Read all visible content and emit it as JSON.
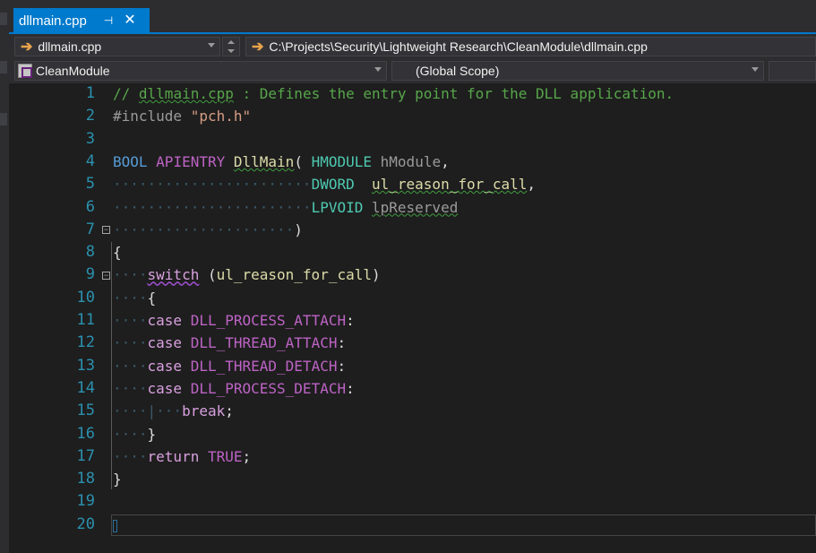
{
  "tab": {
    "label": "dllmain.cpp",
    "pin_glyph": "⊣",
    "close_glyph": "✕",
    "active_color": "#007acc"
  },
  "nav": {
    "file_combo": "dllmain.cpp",
    "path": "C:\\Projects\\Security\\Lightweight Research\\CleanModule\\dllmain.cpp",
    "project_combo": "CleanModule",
    "scope_combo": "(Global Scope)"
  },
  "lines": [
    {
      "n": "1",
      "parts": [
        [
          "c-comment",
          "// "
        ],
        [
          "c-comment squig",
          "dllmain.cpp"
        ],
        [
          "c-comment",
          " : Defines the entry point for the DLL application."
        ]
      ]
    },
    {
      "n": "2",
      "parts": [
        [
          "c-pp",
          "#include "
        ],
        [
          "c-str",
          "\"pch.h\""
        ]
      ]
    },
    {
      "n": "3",
      "parts": []
    },
    {
      "n": "4",
      "parts": [
        [
          "c-kw",
          "BOOL"
        ],
        [
          "",
          " "
        ],
        [
          "c-macro",
          "APIENTRY"
        ],
        [
          "",
          " "
        ],
        [
          "c-func squig",
          "DllMain"
        ],
        [
          "",
          "( "
        ],
        [
          "c-type",
          "HMODULE"
        ],
        [
          "",
          " "
        ],
        [
          "c-param",
          "hModule"
        ],
        [
          "",
          ","
        ]
      ]
    },
    {
      "n": "5",
      "parts": [
        [
          "c-dots",
          "·······················"
        ],
        [
          "c-type",
          "DWORD"
        ],
        [
          "",
          "  "
        ],
        [
          "c-func squig",
          "ul_reason_for_call"
        ],
        [
          "",
          ","
        ]
      ]
    },
    {
      "n": "6",
      "parts": [
        [
          "c-dots",
          "·······················"
        ],
        [
          "c-type",
          "LPVOID"
        ],
        [
          "",
          " "
        ],
        [
          "c-param squig",
          "lpReserved"
        ]
      ]
    },
    {
      "n": "7",
      "parts": [
        [
          "c-dots",
          "·····················"
        ],
        [
          "",
          ")"
        ]
      ]
    },
    {
      "n": "8",
      "parts": [
        [
          "",
          "{"
        ]
      ]
    },
    {
      "n": "9",
      "parts": [
        [
          "c-dots",
          "····"
        ],
        [
          "c-ctl squig-purple",
          "switch"
        ],
        [
          "",
          " ("
        ],
        [
          "c-func",
          "ul_reason_for_call"
        ],
        [
          "",
          ")"
        ]
      ]
    },
    {
      "n": "10",
      "parts": [
        [
          "c-dots",
          "····"
        ],
        [
          "",
          "{"
        ]
      ]
    },
    {
      "n": "11",
      "parts": [
        [
          "c-dots",
          "····"
        ],
        [
          "c-ctl",
          "case"
        ],
        [
          "",
          " "
        ],
        [
          "c-macro",
          "DLL_PROCESS_ATTACH"
        ],
        [
          "",
          ":"
        ]
      ]
    },
    {
      "n": "12",
      "parts": [
        [
          "c-dots",
          "····"
        ],
        [
          "c-ctl",
          "case"
        ],
        [
          "",
          " "
        ],
        [
          "c-macro",
          "DLL_THREAD_ATTACH"
        ],
        [
          "",
          ":"
        ]
      ]
    },
    {
      "n": "13",
      "parts": [
        [
          "c-dots",
          "····"
        ],
        [
          "c-ctl",
          "case"
        ],
        [
          "",
          " "
        ],
        [
          "c-macro",
          "DLL_THREAD_DETACH"
        ],
        [
          "",
          ":"
        ]
      ]
    },
    {
      "n": "14",
      "parts": [
        [
          "c-dots",
          "····"
        ],
        [
          "c-ctl",
          "case"
        ],
        [
          "",
          " "
        ],
        [
          "c-macro",
          "DLL_PROCESS_DETACH"
        ],
        [
          "",
          ":"
        ]
      ]
    },
    {
      "n": "15",
      "parts": [
        [
          "c-dots",
          "····|···"
        ],
        [
          "c-ctl",
          "break"
        ],
        [
          "",
          ";"
        ]
      ]
    },
    {
      "n": "16",
      "parts": [
        [
          "c-dots",
          "····"
        ],
        [
          "",
          "}"
        ]
      ]
    },
    {
      "n": "17",
      "parts": [
        [
          "c-dots",
          "····"
        ],
        [
          "c-ctl",
          "return"
        ],
        [
          "",
          " "
        ],
        [
          "c-macro",
          "TRUE"
        ],
        [
          "",
          ";"
        ]
      ]
    },
    {
      "n": "18",
      "parts": [
        [
          "",
          "}"
        ]
      ]
    },
    {
      "n": "19",
      "parts": []
    },
    {
      "n": "20",
      "parts": []
    }
  ]
}
